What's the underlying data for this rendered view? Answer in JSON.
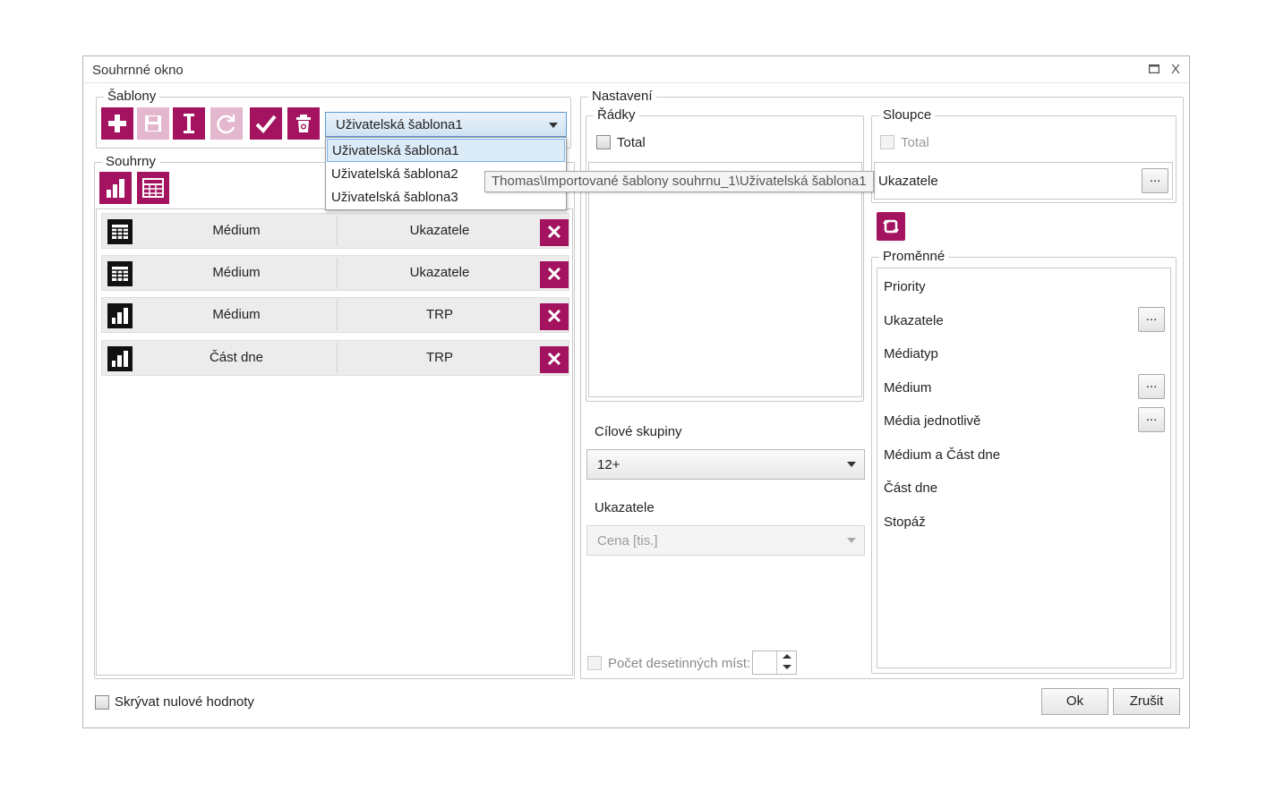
{
  "window": {
    "title": "Souhrnné okno",
    "maximize_icon": "maximize-icon",
    "close_label": "X"
  },
  "templates": {
    "group_label": "Šablony",
    "toolbar": [
      {
        "name": "add-template-button",
        "icon": "plus-icon",
        "disabled": false
      },
      {
        "name": "save-template-button",
        "icon": "save-icon",
        "disabled": true
      },
      {
        "name": "rename-template-button",
        "icon": "text-cursor-icon",
        "disabled": false
      },
      {
        "name": "refresh-template-button",
        "icon": "refresh-icon",
        "disabled": true
      },
      {
        "name": "apply-template-button",
        "icon": "check-icon",
        "disabled": false
      },
      {
        "name": "delete-template-button",
        "icon": "trash-icon",
        "disabled": false
      }
    ],
    "selected": "Uživatelská šablona1",
    "options": [
      "Uživatelská šablona1",
      "Uživatelská šablona2",
      "Uživatelská šablona3"
    ],
    "tooltip": "Thomas\\Importované šablony souhrnu_1\\Uživatelská šablona1"
  },
  "summaries": {
    "group_label": "Souhrny",
    "rows": [
      {
        "icon": "table-icon",
        "col1": "Médium",
        "col2": "Ukazatele"
      },
      {
        "icon": "table-icon",
        "col1": "Médium",
        "col2": "Ukazatele"
      },
      {
        "icon": "bar-chart-icon",
        "col1": "Médium",
        "col2": "TRP"
      },
      {
        "icon": "bar-chart-icon",
        "col1": "Část dne",
        "col2": "TRP"
      }
    ]
  },
  "settings": {
    "group_label": "Nastavení",
    "rows_group": {
      "label": "Řádky",
      "total_label": "Total"
    },
    "target_groups": {
      "label": "Cílové skupiny",
      "value": "12+"
    },
    "indicators": {
      "label": "Ukazatele",
      "value": "Cena [tis.]"
    },
    "decimals_label": "Počet desetinných míst:",
    "columns_group": {
      "label": "Sloupce",
      "total_label": "Total",
      "item": "Ukazatele",
      "ellipsis": "..."
    },
    "variables": {
      "label": "Proměnné",
      "items": [
        {
          "label": "Priority",
          "has_button": false
        },
        {
          "label": "Ukazatele",
          "has_button": true
        },
        {
          "label": "Médiatyp",
          "has_button": false
        },
        {
          "label": "Médium",
          "has_button": true
        },
        {
          "label": "Média jednotlivě",
          "has_button": true
        },
        {
          "label": "Médium a Část dne",
          "has_button": false
        },
        {
          "label": "Část dne",
          "has_button": false
        },
        {
          "label": "Stopáž",
          "has_button": false
        }
      ],
      "ellipsis": "..."
    }
  },
  "footer": {
    "hide_zero_label": "Skrývat nulové hodnoty",
    "ok_label": "Ok",
    "cancel_label": "Zrušit"
  },
  "colors": {
    "accent": "#a3135f",
    "accent_disabled": "#e3b7cd",
    "combo_focus": "#5b9bd5"
  }
}
